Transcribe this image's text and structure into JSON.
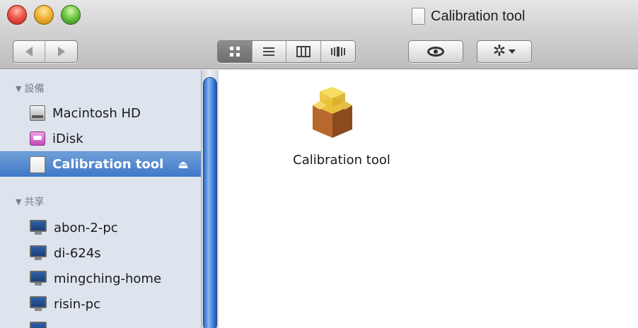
{
  "window": {
    "title": "Calibration tool"
  },
  "toolbar": {
    "nav": {
      "back_icon": "back-arrow-icon",
      "forward_icon": "forward-arrow-icon"
    },
    "view_modes": [
      {
        "name": "icon-view",
        "active": true
      },
      {
        "name": "list-view",
        "active": false
      },
      {
        "name": "column-view",
        "active": false
      },
      {
        "name": "coverflow-view",
        "active": false
      }
    ],
    "quicklook_icon": "eye-icon",
    "action_icon": "gear-icon"
  },
  "sidebar": {
    "devices_header": "設備",
    "devices": [
      {
        "label": "Macintosh HD",
        "icon": "hard-drive-icon"
      },
      {
        "label": "iDisk",
        "icon": "idisk-icon"
      },
      {
        "label": "Calibration tool",
        "icon": "volume-icon",
        "selected": true,
        "eject": "⏏"
      }
    ],
    "shared_header": "共享",
    "shared": [
      {
        "label": "abon-2-pc",
        "icon": "computer-icon"
      },
      {
        "label": "di-624s",
        "icon": "computer-icon"
      },
      {
        "label": "mingching-home",
        "icon": "computer-icon"
      },
      {
        "label": "risin-pc",
        "icon": "computer-icon"
      }
    ]
  },
  "content": {
    "items": [
      {
        "label": "Calibration tool",
        "icon": "package-icon"
      }
    ]
  },
  "colors": {
    "selection": "#3f78c8",
    "sidebar_bg": "#dde4ed"
  }
}
